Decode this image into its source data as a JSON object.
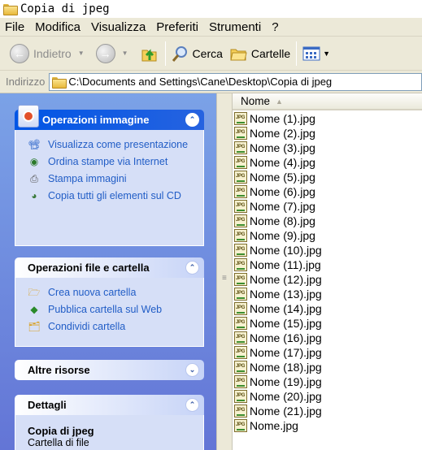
{
  "window": {
    "title": "Copia di jpeg"
  },
  "menu": [
    "File",
    "Modifica",
    "Visualizza",
    "Preferiti",
    "Strumenti",
    "?"
  ],
  "toolbar": {
    "back": "Indietro",
    "search": "Cerca",
    "folders": "Cartelle"
  },
  "address": {
    "label": "Indirizzo",
    "path": "C:\\Documents and Settings\\Cane\\Desktop\\Copia di jpeg"
  },
  "taskpane": {
    "image_tasks": {
      "title": "Operazioni immagine",
      "items": [
        "Visualizza come presentazione",
        "Ordina stampe via Internet",
        "Stampa immagini",
        "Copia tutti gli elementi sul CD"
      ]
    },
    "file_tasks": {
      "title": "Operazioni file e cartella",
      "items": [
        "Crea nuova cartella",
        "Pubblica cartella sul Web",
        "Condividi cartella"
      ]
    },
    "other_places": {
      "title": "Altre risorse"
    },
    "details": {
      "title": "Dettagli",
      "name": "Copia di jpeg",
      "type": "Cartella di file"
    }
  },
  "list": {
    "column": "Nome",
    "files": [
      "Nome (1).jpg",
      "Nome (2).jpg",
      "Nome (3).jpg",
      "Nome (4).jpg",
      "Nome (5).jpg",
      "Nome (6).jpg",
      "Nome (7).jpg",
      "Nome (8).jpg",
      "Nome (9).jpg",
      "Nome (10).jpg",
      "Nome (11).jpg",
      "Nome (12).jpg",
      "Nome (13).jpg",
      "Nome (14).jpg",
      "Nome (15).jpg",
      "Nome (16).jpg",
      "Nome (17).jpg",
      "Nome (18).jpg",
      "Nome (19).jpg",
      "Nome (20).jpg",
      "Nome (21).jpg",
      "Nome.jpg"
    ]
  }
}
